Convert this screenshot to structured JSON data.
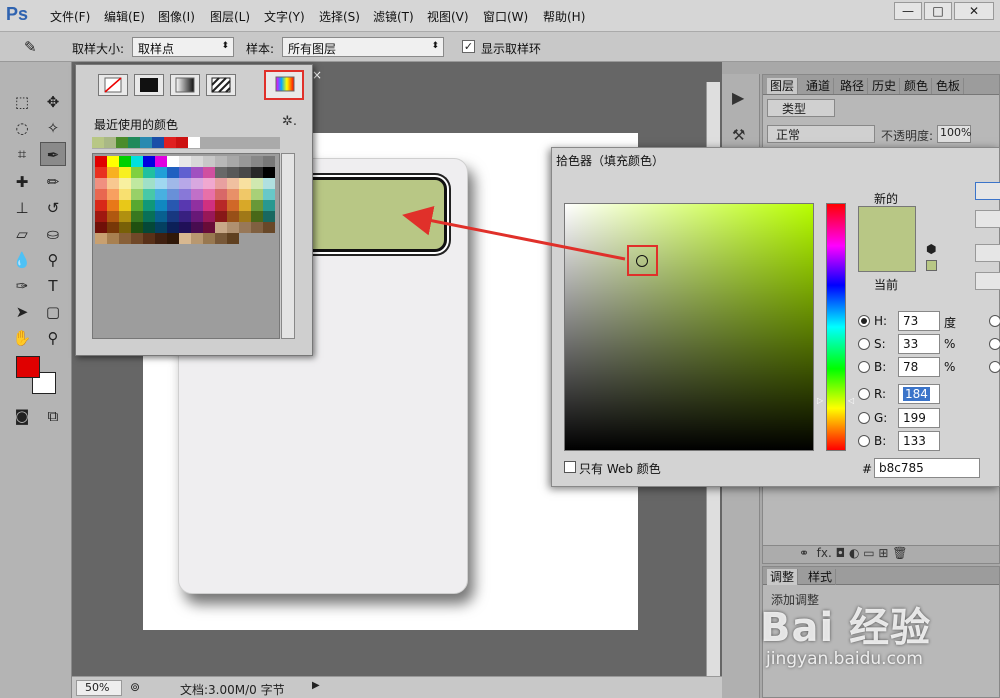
{
  "app": {
    "logo": "Ps"
  },
  "menu": [
    "文件(F)",
    "编辑(E)",
    "图像(I)",
    "图层(L)",
    "文字(Y)",
    "选择(S)",
    "滤镜(T)",
    "视图(V)",
    "窗口(W)",
    "帮助(H)"
  ],
  "window_controls": {
    "minimize": "—",
    "maximize": "□",
    "close": "✕"
  },
  "options": {
    "sample_size_label": "取样大小:",
    "sample_size_value": "取样点",
    "sample_label": "样本:",
    "sample_value": "所有图层",
    "show_ring_label": "显示取样环",
    "show_ring_checked": true
  },
  "tab_close": "×",
  "swatch_panel": {
    "recent_label": "最近使用的颜色",
    "recent_colors": [
      "#b8c785",
      "#a9b885",
      "#4a8c2a",
      "#1f8a5a",
      "#2a8ab0",
      "#1a4ea8",
      "#e01f1f",
      "#cc1111",
      "#ffffff"
    ],
    "grid_colors": [
      [
        "#e00000",
        "#ffff00",
        "#00d000",
        "#00e0e0",
        "#0000e0",
        "#e000e0",
        "#ffffff",
        "#e8e8e8",
        "#d8d8d8",
        "#c8c8c8",
        "#b8b8b8",
        "#a8a8a8",
        "#989898",
        "#888888",
        "#787878"
      ],
      [
        "#e83020",
        "#f8b020",
        "#f8f020",
        "#80d040",
        "#20c0a0",
        "#20a0d8",
        "#2060c0",
        "#6060d0",
        "#a050c0",
        "#d050a0",
        "#686868",
        "#585858",
        "#484848",
        "#282828",
        "#000000"
      ],
      [
        "#f09080",
        "#f8c890",
        "#f8f0a0",
        "#c0e8a0",
        "#a0e0c8",
        "#a0d8f0",
        "#a0b8e8",
        "#b8a8e8",
        "#d8a8e0",
        "#f0a8d0",
        "#e8a0a0",
        "#f0c0a0",
        "#f8e0a0",
        "#d0e8b0",
        "#b0e0e0"
      ],
      [
        "#e86850",
        "#f8a060",
        "#f8e070",
        "#98d068",
        "#48c8a8",
        "#48b0e0",
        "#6890d8",
        "#8878d8",
        "#c070c8",
        "#e870a8",
        "#d86868",
        "#e89068",
        "#f0c868",
        "#a8d078",
        "#68c8c8"
      ],
      [
        "#d82818",
        "#e87818",
        "#e8c818",
        "#58a830",
        "#109878",
        "#1088c0",
        "#2858b0",
        "#5838b0",
        "#9030a0",
        "#d03080",
        "#b82828",
        "#d06828",
        "#d8a828",
        "#689838",
        "#289890"
      ],
      [
        "#a01810",
        "#b05810",
        "#b09010",
        "#387820",
        "#087058",
        "#086090",
        "#183880",
        "#382080",
        "#681878",
        "#981858",
        "#881818",
        "#985018",
        "#a07818",
        "#486818",
        "#186860"
      ],
      [
        "#701008",
        "#783808",
        "#786008",
        "#205010",
        "#044838",
        "#044060",
        "#0c2058",
        "#201058",
        "#480c50",
        "#680c38",
        "#c8a888",
        "#b09070",
        "#987858",
        "#806040",
        "#684828"
      ],
      [
        "#c8a070",
        "#a88050",
        "#886038",
        "#704828",
        "#583018",
        "#402010",
        "#301808",
        "#d8b890",
        "#b89870",
        "#987850",
        "#785838",
        "#604020",
        "#",
        "#",
        ""
      ]
    ]
  },
  "color_picker": {
    "title": "拾色器（填充颜色）",
    "new_label": "新的",
    "current_label": "当前",
    "new_color": "#b8c785",
    "current_color": "#b8c785",
    "fields": {
      "H": {
        "label": "H:",
        "value": "73",
        "unit": "度",
        "selected": true
      },
      "S": {
        "label": "S:",
        "value": "33",
        "unit": "%"
      },
      "Bv": {
        "label": "B:",
        "value": "78",
        "unit": "%"
      },
      "R": {
        "label": "R:",
        "value": "184"
      },
      "G": {
        "label": "G:",
        "value": "199"
      },
      "B": {
        "label": "B:",
        "value": "133"
      }
    },
    "hex_label": "#",
    "hex_value": "b8c785",
    "web_only_label": "只有 Web 颜色"
  },
  "right_panel": {
    "tabs": [
      "图层",
      "通道",
      "路径",
      "历史",
      "颜色",
      "色板"
    ],
    "filter_label": "类型",
    "blend_mode": "正常",
    "opacity_label": "不透明度:",
    "opacity_value": "100%",
    "adj_tabs": [
      "调整",
      "样式"
    ],
    "adj_title": "添加调整"
  },
  "status": {
    "zoom": "50%",
    "doc_info": "文档:3.00M/0 字节"
  },
  "watermark": {
    "brand": "Bai 经验",
    "url": "jingyan.baidu.com"
  }
}
